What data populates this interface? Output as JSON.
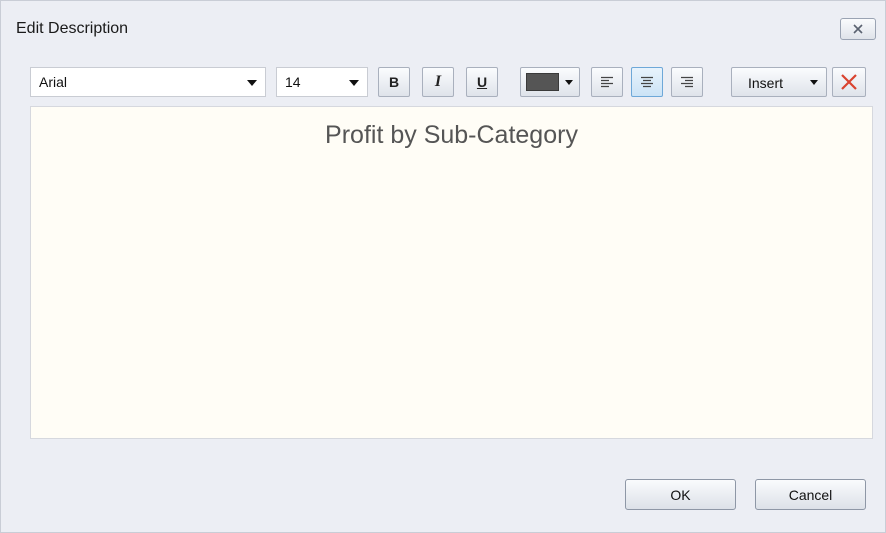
{
  "window": {
    "title": "Edit Description",
    "close_icon": "close-x-icon"
  },
  "toolbar": {
    "font_family": "Arial",
    "font_size": "14",
    "bold_label": "B",
    "italic_label": "I",
    "underline_label": "U",
    "text_color": "#555555",
    "align_left_icon": "align-left-icon",
    "align_center_icon": "align-center-icon",
    "align_right_icon": "align-right-icon",
    "active_alignment": "center",
    "insert_label": "Insert",
    "clear_icon": "red-x-icon"
  },
  "editor": {
    "content": "Profit by Sub-Category",
    "background": "#fffdf6"
  },
  "buttons": {
    "ok_label": "OK",
    "cancel_label": "Cancel"
  }
}
